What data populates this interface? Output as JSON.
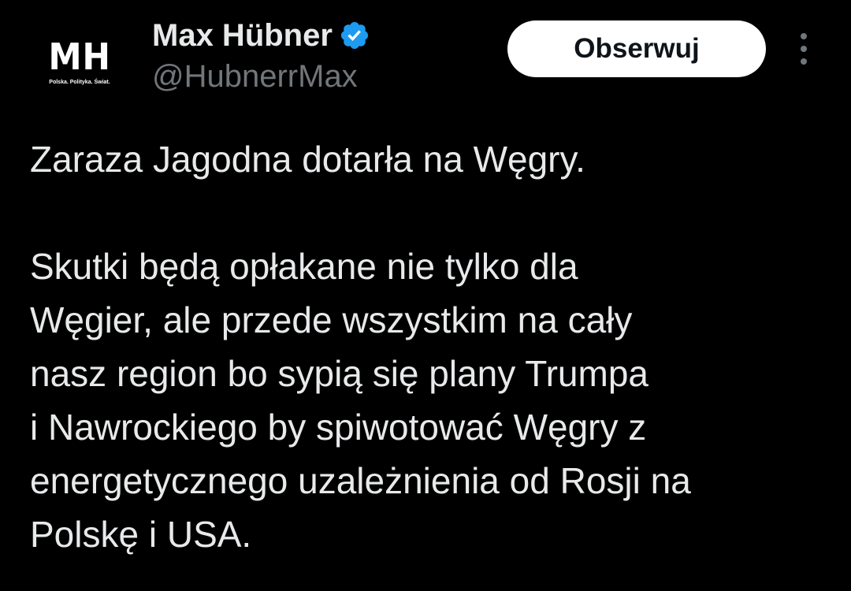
{
  "author": {
    "display_name": "Max Hübner",
    "handle": "@HubnerrMax",
    "verified": true,
    "avatar": {
      "logo_text": "MH",
      "tagline": "Polska. Polityka. Świat."
    }
  },
  "actions": {
    "follow_label": "Obserwuj",
    "more_icon": "more-vertical-icon"
  },
  "tweet": {
    "paragraph_1": "Zaraza Jagodna dotarła na Węgry.",
    "paragraph_2": "Skutki będą opłakane nie tylko dla\nWęgier, ale przede wszystkim na cały\nnasz region bo sypią się plany Trumpa\ni Nawrockiego by spiwotować Węgry z\nenergetycznego uzależnienia od Rosji na\nPolskę i USA."
  },
  "colors": {
    "background": "#000000",
    "text_primary": "#e7e9ea",
    "text_secondary": "#71767b",
    "verified_badge": "#1d9bf0",
    "button_bg": "#ffffff",
    "button_text": "#0f1419"
  }
}
